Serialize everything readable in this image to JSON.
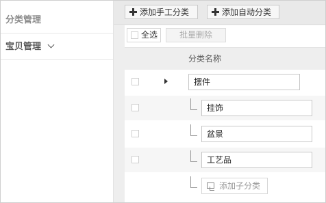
{
  "sidebar": {
    "items": [
      {
        "label": "分类管理"
      },
      {
        "label": "宝贝管理"
      }
    ]
  },
  "toolbar": {
    "add_manual_label": "添加手工分类",
    "add_auto_label": "添加自动分类"
  },
  "selection": {
    "select_all_label": "全选",
    "batch_delete_label": "批量删除"
  },
  "table": {
    "column_header": "分类名称",
    "parent_category": "摆件",
    "subcategories": [
      "挂饰",
      "盆景",
      "工艺品"
    ],
    "add_subcategory_label": "添加子分类"
  }
}
